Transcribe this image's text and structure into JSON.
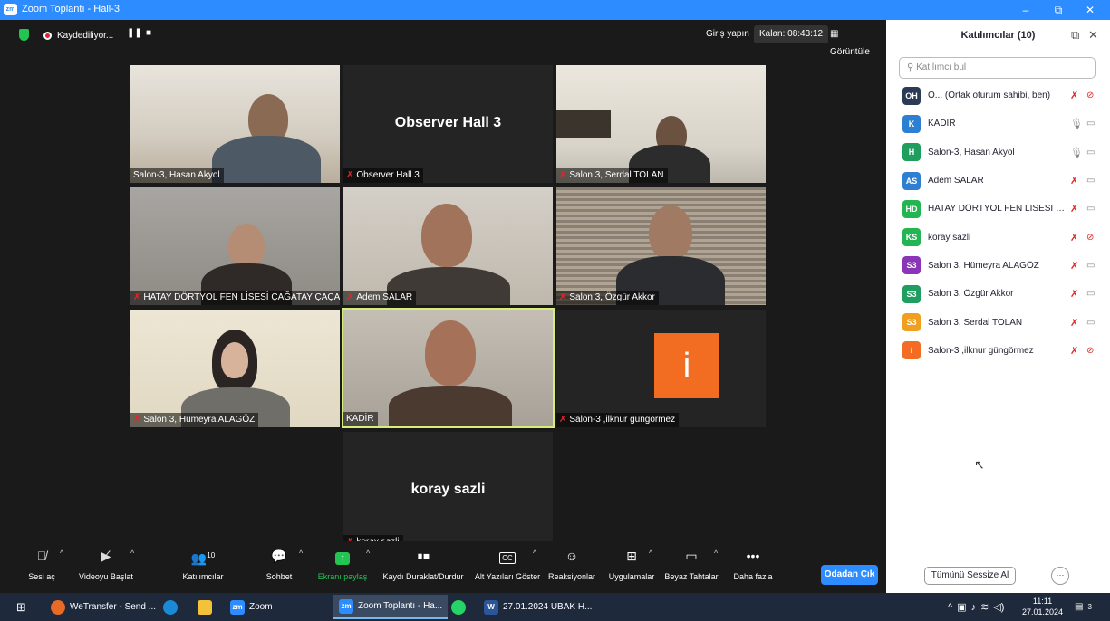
{
  "window": {
    "title": "Zoom Toplantı - Hall-3",
    "app_logo": "zm",
    "minimize": "–",
    "restore": "⧉",
    "close": "✕"
  },
  "topbar": {
    "recording_label": "Kaydediliyor...",
    "signin": "Giriş yapın",
    "remaining": "Kalan: 08:43:12",
    "view": "Görüntüle"
  },
  "tiles": [
    {
      "name": "Salon-3, Hasan Akyol",
      "muted": false,
      "big": ""
    },
    {
      "name": "Observer Hall 3",
      "muted": true,
      "big": "Observer Hall 3"
    },
    {
      "name": "Salon 3, Serdal TOLAN",
      "muted": true,
      "big": ""
    },
    {
      "name": "HATAY DÖRTYOL FEN LİSESİ ÇAĞATAY ÇAÇA",
      "muted": true,
      "big": ""
    },
    {
      "name": "Adem SALAR",
      "muted": true,
      "big": ""
    },
    {
      "name": "Salon 3, Özgür Akkor",
      "muted": true,
      "big": ""
    },
    {
      "name": "Salon 3, Hümeyra ALAGÖZ",
      "muted": true,
      "big": ""
    },
    {
      "name": "KADİR",
      "muted": false,
      "big": ""
    },
    {
      "name": "Salon-3 ,ilknur güngörmez",
      "muted": true,
      "big": "",
      "avatar_letter": "i"
    },
    {
      "name": "koray sazli",
      "muted": true,
      "big": "koray sazli"
    }
  ],
  "toolbar": {
    "unmute": "Sesi aç",
    "start_video": "Videoyu Başlat",
    "participants": "Katılımcılar",
    "participants_count": "10",
    "chat": "Sohbet",
    "share": "Ekranı paylaş",
    "pause_rec": "Kaydı Duraklat/Durdur",
    "captions": "Alt Yazıları Göster",
    "reactions": "Reaksiyonlar",
    "apps": "Uygulamalar",
    "whiteboard": "Beyaz Tahtalar",
    "more": "Daha fazla",
    "leave": "Odadan Çık"
  },
  "panel": {
    "title": "Katılımcılar (10)",
    "search_placeholder": "Katılımcı bul",
    "mute_all": "Tümünü Sessize Al",
    "more": "···",
    "participants": [
      {
        "initials": "OH",
        "name": "O... (Ortak oturum sahibi, ben)",
        "color": "#2b3a55",
        "mic": "muted",
        "cam": "off"
      },
      {
        "initials": "K",
        "name": "KADİR",
        "color": "#2d7fd2",
        "mic": "on",
        "cam": "on"
      },
      {
        "initials": "H",
        "name": "Salon-3, Hasan Akyol",
        "color": "#1f9e60",
        "mic": "on",
        "cam": "on"
      },
      {
        "initials": "AS",
        "name": "Adem SALAR",
        "color": "#2d7fd2",
        "mic": "muted",
        "cam": "on"
      },
      {
        "initials": "HD",
        "name": "HATAY DÖRTYOL FEN LİSESİ ÇAĞ...",
        "color": "#23b552",
        "mic": "muted",
        "cam": "on"
      },
      {
        "initials": "KS",
        "name": "koray sazli",
        "color": "#23b552",
        "mic": "muted",
        "cam": "off"
      },
      {
        "initials": "S3",
        "name": "Salon 3, Hümeyra ALAGÖZ",
        "color": "#8a35b8",
        "mic": "muted",
        "cam": "on"
      },
      {
        "initials": "S3",
        "name": "Salon 3, Özgür Akkor",
        "color": "#1f9e60",
        "mic": "muted",
        "cam": "on"
      },
      {
        "initials": "S3",
        "name": "Salon 3, Serdal TOLAN",
        "color": "#f0a020",
        "mic": "muted",
        "cam": "on"
      },
      {
        "initials": "i",
        "name": "Salon-3 ,ilknur güngörmez",
        "color": "#f26d21",
        "mic": "muted",
        "cam": "off"
      }
    ]
  },
  "taskbar": {
    "items": [
      "WeTransfer - Send ...",
      "Zoom",
      "Zoom Toplantı - Ha...",
      "27.01.2024 UBAK H..."
    ],
    "time": "11:11",
    "date": "27.01.2024",
    "notif": "3"
  }
}
